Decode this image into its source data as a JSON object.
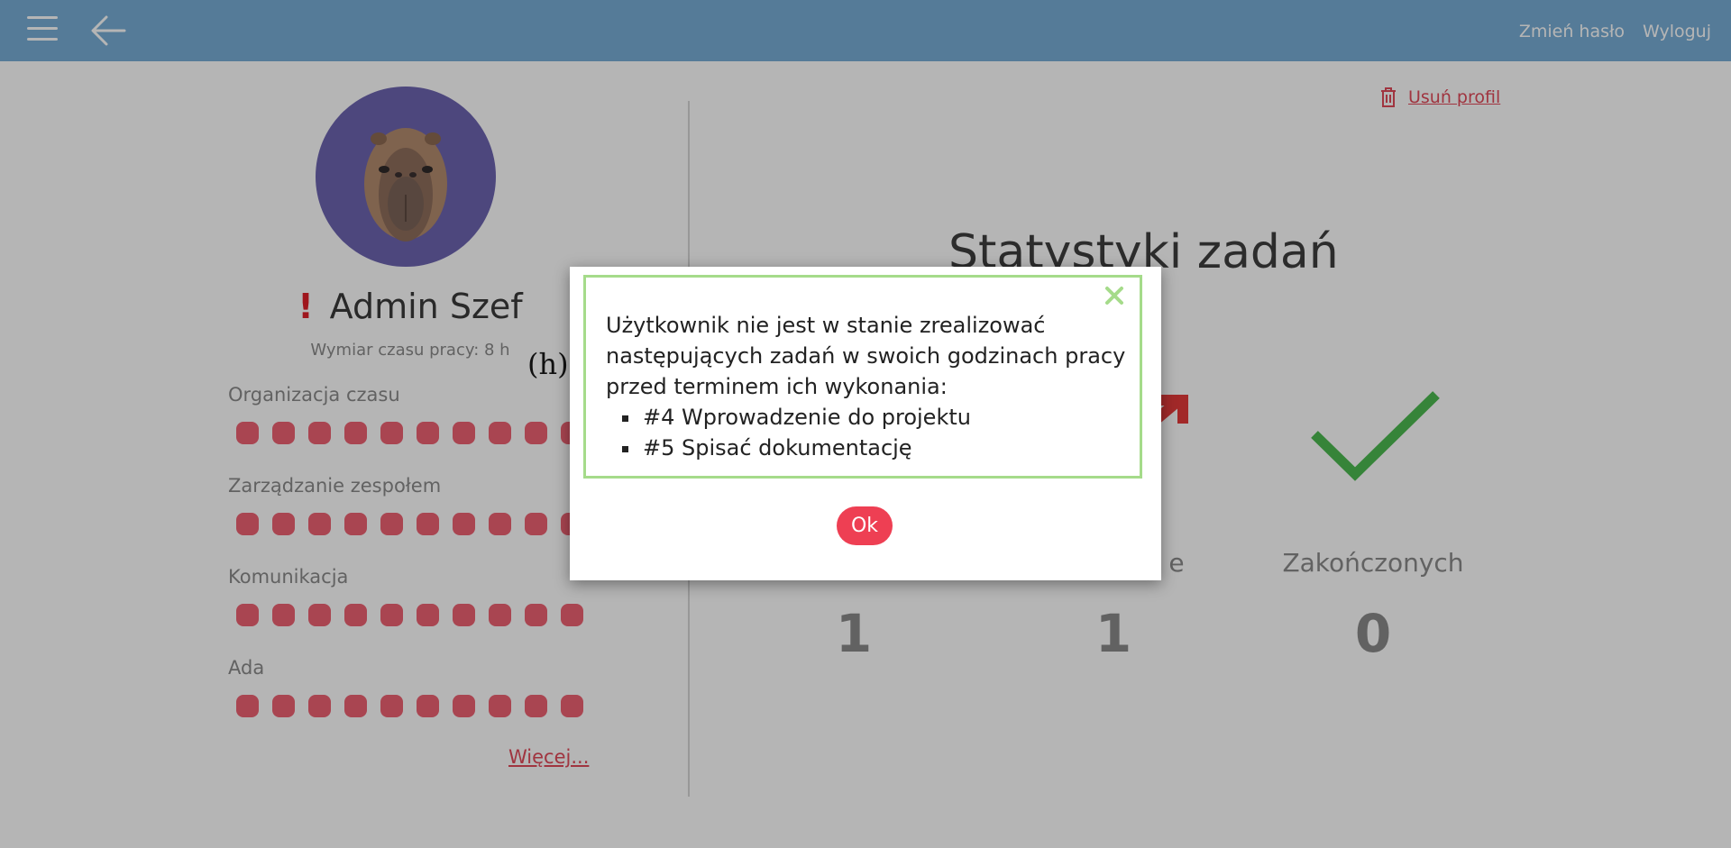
{
  "header": {
    "change_password": "Zmień hasło",
    "logout": "Wyloguj"
  },
  "profile": {
    "name": "Admin Szef",
    "alert_mark": "!",
    "work_time": "Wymiar czasu pracy: 8 h",
    "skills": [
      {
        "label": "Organizacja czasu",
        "level": 10,
        "max": 10
      },
      {
        "label": "Zarządzanie zespołem",
        "level": 10,
        "max": 10
      },
      {
        "label": "Komunikacja",
        "level": 10,
        "max": 10
      },
      {
        "label": "Ada",
        "level": 10,
        "max": 10
      }
    ],
    "more_link": "Więcej..."
  },
  "stats": {
    "delete_profile": "Usuń profil",
    "title": "Statystyki zadań",
    "columns": [
      {
        "label": "",
        "value": "1"
      },
      {
        "label": "e",
        "value": "1"
      },
      {
        "label": "Zakończonych",
        "value": "0"
      }
    ]
  },
  "stray_label": "(h)",
  "modal": {
    "message": "Użytkownik nie jest w stanie zrealizować następujących zadań w swoich godzinach pracy przed terminem ich wykonania:",
    "tasks": [
      "#4 Wprowadzenie do projektu",
      "#5 Spisać dokumentację"
    ],
    "ok_label": "Ok"
  },
  "colors": {
    "topbar": "#78aed6",
    "accent_red": "#ee3f53",
    "modal_border": "#a5db8a",
    "check_green": "#4cba51"
  }
}
